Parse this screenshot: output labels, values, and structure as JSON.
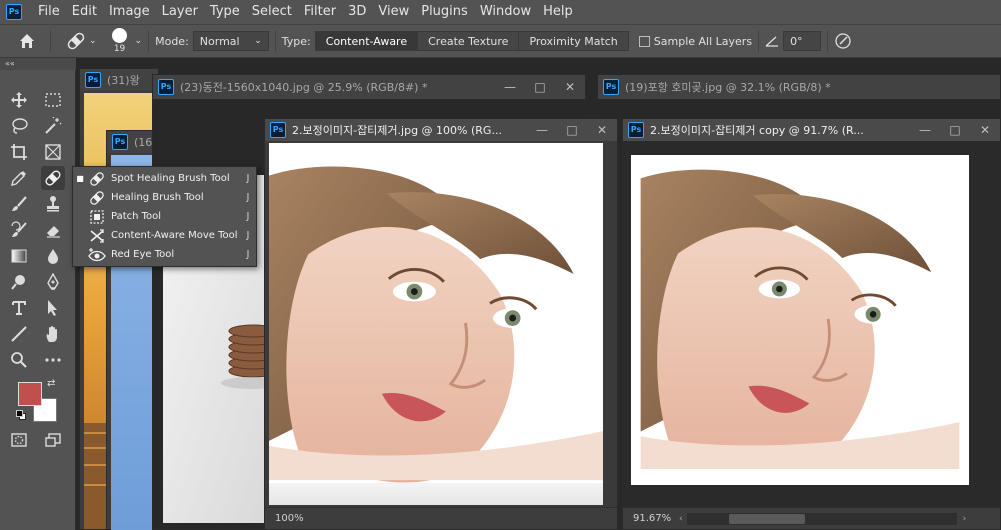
{
  "app": {
    "logo": "Ps"
  },
  "menu": [
    "File",
    "Edit",
    "Image",
    "Layer",
    "Type",
    "Select",
    "Filter",
    "3D",
    "View",
    "Plugins",
    "Window",
    "Help"
  ],
  "options": {
    "brush_size": "19",
    "mode_label": "Mode:",
    "mode_value": "Normal",
    "type_label": "Type:",
    "type_buttons": [
      "Content-Aware",
      "Create Texture",
      "Proximity Match"
    ],
    "sample_all_layers": "Sample All Layers",
    "angle_value": "0°"
  },
  "toolbar": {
    "collapse": "««",
    "foreground_color": "#c0504d",
    "background_color": "#ffffff"
  },
  "flyout": {
    "items": [
      {
        "label": "Spot Healing Brush Tool",
        "shortcut": "J",
        "selected": true
      },
      {
        "label": "Healing Brush Tool",
        "shortcut": "J"
      },
      {
        "label": "Patch Tool",
        "shortcut": "J"
      },
      {
        "label": "Content-Aware Move Tool",
        "shortcut": "J"
      },
      {
        "label": "Red Eye Tool",
        "shortcut": "J"
      }
    ]
  },
  "documents": [
    {
      "title": "(31)왕"
    },
    {
      "title": "(16)"
    },
    {
      "title": "(23)동전-1560x1040.jpg @ 25.9% (RGB/8#) *"
    },
    {
      "title": "(19)포항 호미곶.jpg @ 32.1% (RGB/8) *"
    },
    {
      "title": "2.보정이미지-잡티제거.jpg @ 100% (RG...",
      "zoom": "100%"
    },
    {
      "title": "2.보정이미지-잡티제거 copy @ 91.7% (R...",
      "zoom": "91.67%"
    }
  ],
  "window_controls": {
    "minimize": "—",
    "maximize": "□",
    "close": "✕"
  }
}
